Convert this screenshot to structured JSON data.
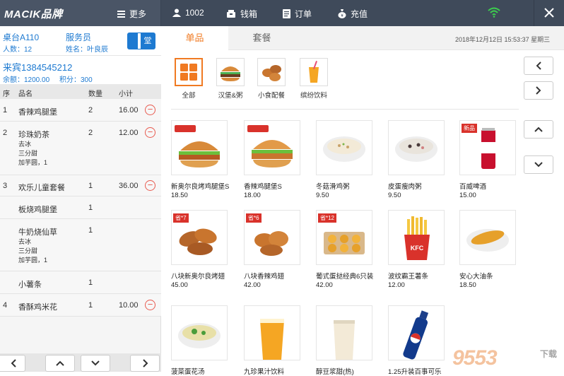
{
  "topbar": {
    "brand": "MACIK品牌",
    "more": "更多",
    "user_id": "1002",
    "cashbox": "钱箱",
    "orders": "订单",
    "recharge": "充值"
  },
  "table": {
    "number": "桌台A110",
    "people": "人数：12",
    "waiter_label": "服务员",
    "waiter_name": "姓名：叶良辰",
    "dine_mode": "堂"
  },
  "member": {
    "phone": "来宾1384545212",
    "balance": "余额：1200.00",
    "points": "积分：300"
  },
  "order_table": {
    "headers": [
      "序",
      "品名",
      "数量",
      "小计"
    ],
    "rows": [
      {
        "index": "1",
        "name": "香辣鸡腿堡",
        "qty": "2",
        "subtotal": "16.00",
        "notes": []
      },
      {
        "index": "2",
        "name": "珍珠奶茶",
        "qty": "2",
        "subtotal": "12.00",
        "notes": [
          "去冰",
          "三分甜",
          "加芋圆，1"
        ]
      },
      {
        "index": "3",
        "name": "欢乐儿童套餐",
        "qty": "1",
        "subtotal": "36.00",
        "notes": []
      },
      {
        "index": "",
        "name": "板烧鸡腿堡",
        "qty": "1",
        "subtotal": "",
        "notes": []
      },
      {
        "index": "",
        "name": "牛奶烧仙草",
        "qty": "1",
        "subtotal": "",
        "notes": [
          "去冰",
          "三分甜",
          "加芋圆，1"
        ]
      },
      {
        "index": "",
        "name": "小薯条",
        "qty": "1",
        "subtotal": "",
        "notes": []
      },
      {
        "index": "4",
        "name": "香酥鸡米花",
        "qty": "1",
        "subtotal": "10.00",
        "notes": []
      }
    ]
  },
  "tabs": [
    "单品",
    "套餐"
  ],
  "datetime": "2018年12月12日 15:53:37  星期三",
  "categories": [
    {
      "label": "全部"
    },
    {
      "label": "汉堡&粥"
    },
    {
      "label": "小食配餐"
    },
    {
      "label": "缤纷饮料"
    }
  ],
  "products": [
    {
      "name": "新奥尔良烤鸡腿堡S",
      "price": "18.50",
      "tag": ""
    },
    {
      "name": "香辣鸡腿堡S",
      "price": "18.00",
      "tag": ""
    },
    {
      "name": "冬菇滑鸡粥",
      "price": "9.50",
      "tag": ""
    },
    {
      "name": "皮蛋瘦肉粥",
      "price": "9.50",
      "tag": ""
    },
    {
      "name": "百威啤酒",
      "price": "15.00",
      "tag": "新品"
    },
    {
      "name": "八块新奥尔良烤翅",
      "price": "45.00",
      "tag": "省*7"
    },
    {
      "name": "八块香辣鸡翅",
      "price": "42.00",
      "tag": "省*6"
    },
    {
      "name": "葡式蛋挞经典6只装",
      "price": "42.00",
      "tag": "省*12"
    },
    {
      "name": "波纹霸王薯条",
      "price": "12.00",
      "tag": ""
    },
    {
      "name": "安心大油条",
      "price": "18.50",
      "tag": ""
    },
    {
      "name": "菠菜蛋花汤",
      "price": "",
      "tag": ""
    },
    {
      "name": "九珍果汁饮料",
      "price": "",
      "tag": ""
    },
    {
      "name": "醇豆浆甜(热)",
      "price": "",
      "tag": ""
    },
    {
      "name": "1.25升装百事可乐",
      "price": "",
      "tag": ""
    }
  ],
  "watermark": {
    "main": "9553",
    "sub": "下载"
  },
  "colors": {
    "topbar": "#3f4a5a",
    "accent": "#f07a22",
    "blue": "#1e7ad1",
    "minus": "#e85a4f",
    "tag": "#d9322b"
  }
}
